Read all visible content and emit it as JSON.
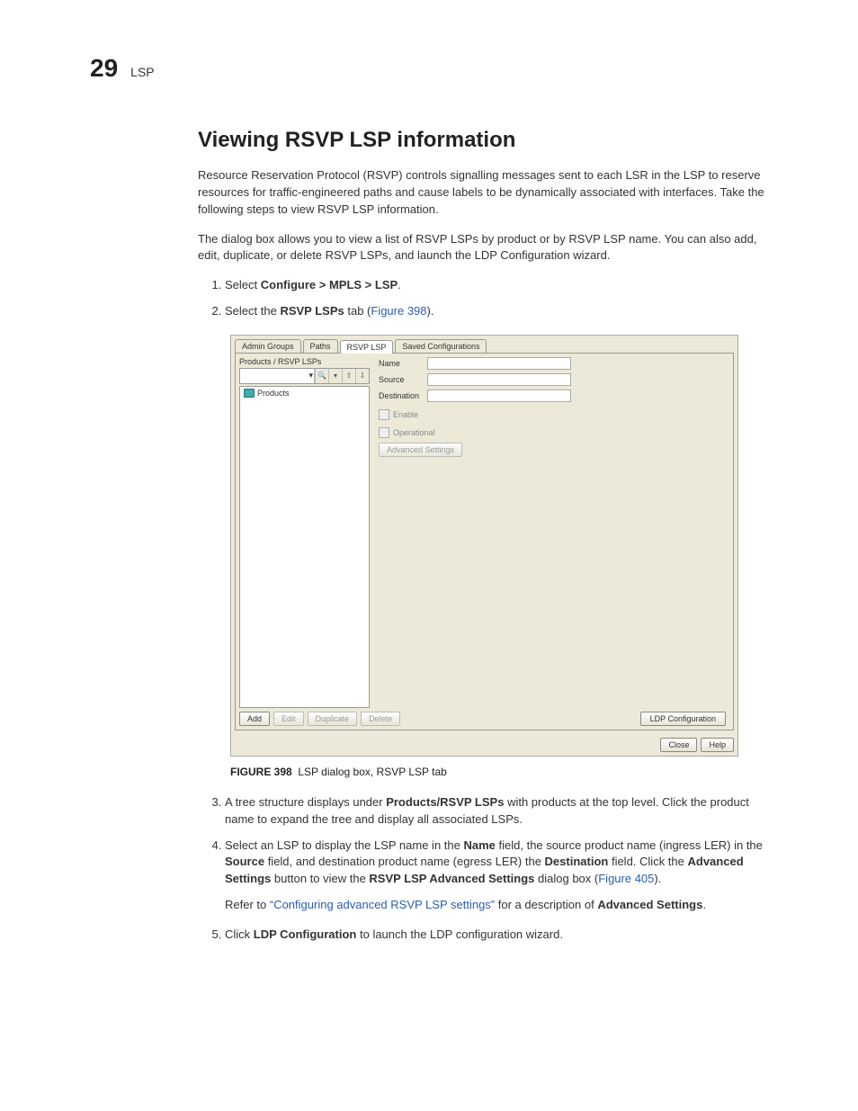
{
  "header": {
    "chapter_number": "29",
    "chapter_title": "LSP"
  },
  "section_heading": "Viewing RSVP LSP information",
  "intro_p1": "Resource Reservation Protocol (RSVP) controls signalling messages sent to each LSR in the LSP to reserve resources for traffic-engineered paths and cause labels to be dynamically associated with interfaces. Take the following steps to view RSVP LSP information.",
  "intro_p2": "The dialog box allows you to view a list of RSVP LSPs by product or by RSVP LSP name. You can also add, edit, duplicate, or delete RSVP LSPs, and launch the LDP Configuration wizard.",
  "steps": {
    "s1": {
      "prefix": "Select ",
      "bold": "Configure > MPLS > LSP",
      "suffix": "."
    },
    "s2": {
      "prefix": "Select the ",
      "bold": "RSVP LSPs",
      "mid": " tab (",
      "link": "Figure 398",
      "suffix": ")."
    },
    "s3": {
      "prefix": "A tree structure displays under ",
      "bold": "Products/RSVP LSPs",
      "suffix": " with products at the top level. Click the product name to expand the tree and display all associated LSPs."
    },
    "s4": {
      "t1": "Select an LSP to display the LSP name in the ",
      "b1": "Name",
      "t2": " field, the source product name (ingress LER) in the ",
      "b2": "Source",
      "t3": " field, and destination product name (egress LER) the ",
      "b3": "Destination",
      "t4": " field. Click the ",
      "b4": "Advanced Settings",
      "t5": " button to view the ",
      "b5": "RSVP LSP Advanced Settings",
      "t6": " dialog box (",
      "link": "Figure 405",
      "t7": ").",
      "refer_pre": "Refer to ",
      "refer_link": "“Configuring advanced RSVP LSP settings”",
      "refer_mid": " for a description of ",
      "refer_bold": "Advanced Settings",
      "refer_suf": "."
    },
    "s5": {
      "prefix": "Click ",
      "bold": "LDP Configuration",
      "suffix": " to launch the LDP configuration wizard."
    }
  },
  "figure": {
    "tabs": [
      "Admin Groups",
      "Paths",
      "RSVP LSP",
      "Saved Configurations"
    ],
    "active_tab_index": 2,
    "sidebar_title": "Products / RSVP LSPs",
    "tree_root": "Products",
    "form": {
      "name_label": "Name",
      "source_label": "Source",
      "dest_label": "Destination",
      "enable_label": "Enable",
      "operational_label": "Operational",
      "adv_btn": "Advanced Settings"
    },
    "left_buttons": [
      "Add",
      "Edit",
      "Duplicate",
      "Delete"
    ],
    "right_button": "LDP Configuration",
    "bottom_buttons": [
      "Close",
      "Help"
    ]
  },
  "figcap": {
    "label": "FIGURE 398",
    "text": "LSP dialog box, RSVP LSP tab"
  }
}
